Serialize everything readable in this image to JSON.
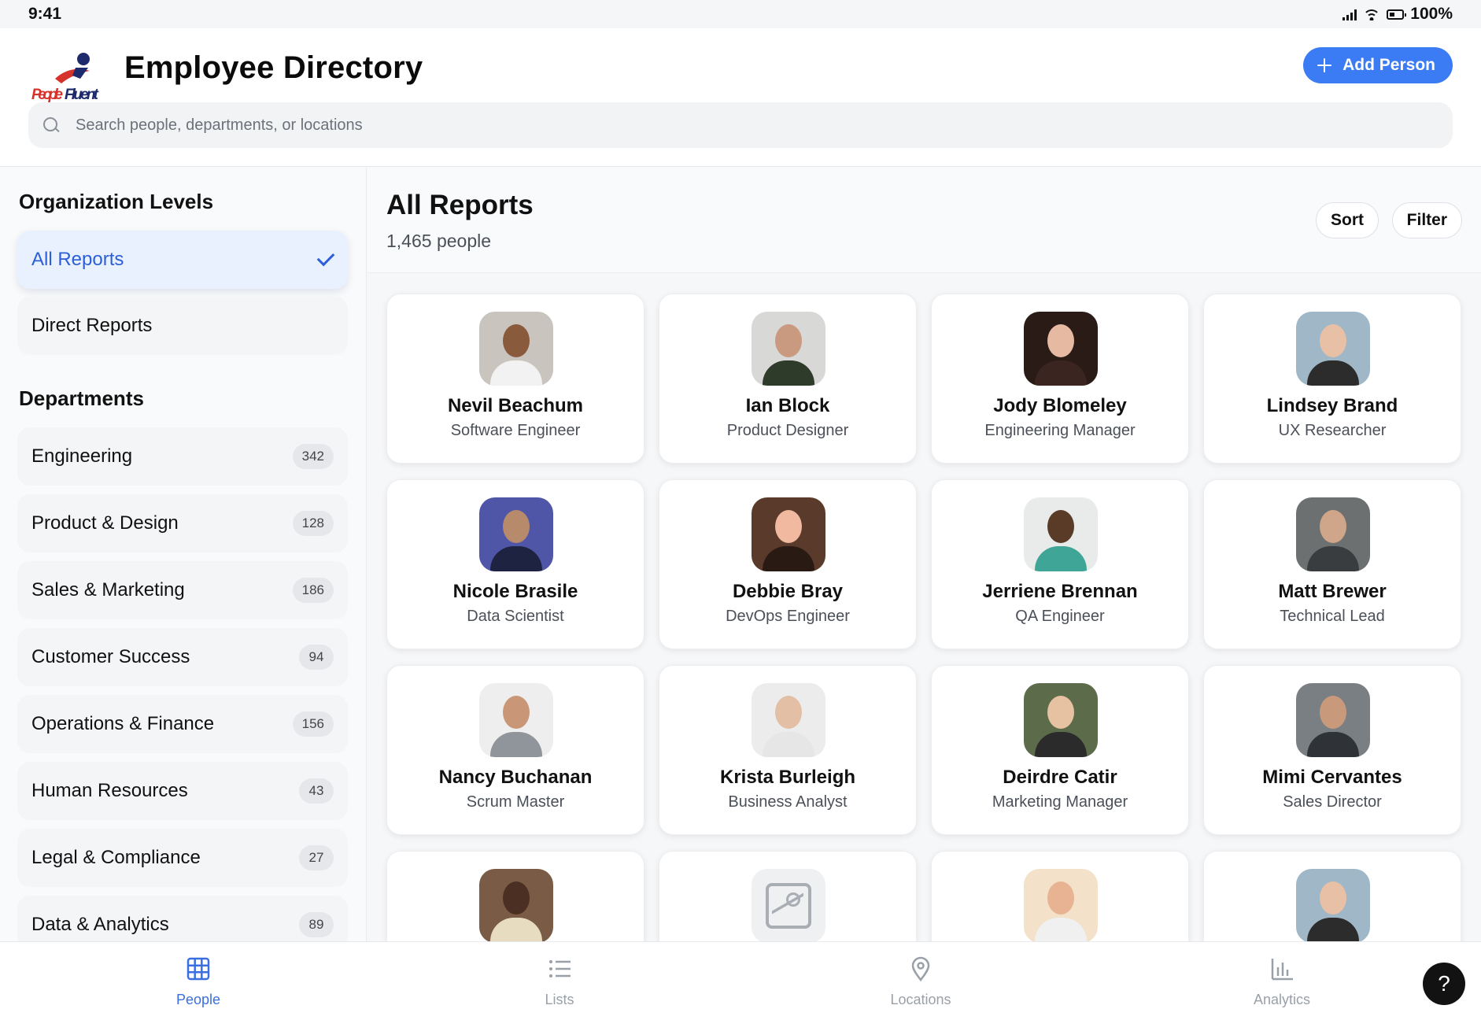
{
  "status": {
    "time": "9:41",
    "battery": "100%"
  },
  "header": {
    "logo_text": "PeopleFluent",
    "title": "Employee Directory",
    "add_label": "Add Person",
    "search_placeholder": "Search people, departments, or locations"
  },
  "sidebar": {
    "levels_heading": "Organization Levels",
    "levels": [
      {
        "label": "All Reports",
        "selected": true
      },
      {
        "label": "Direct Reports",
        "selected": false
      }
    ],
    "departments_heading": "Departments",
    "departments": [
      {
        "label": "Engineering",
        "count": "342"
      },
      {
        "label": "Product & Design",
        "count": "128"
      },
      {
        "label": "Sales & Marketing",
        "count": "186"
      },
      {
        "label": "Customer Success",
        "count": "94"
      },
      {
        "label": "Operations & Finance",
        "count": "156"
      },
      {
        "label": "Human Resources",
        "count": "43"
      },
      {
        "label": "Legal & Compliance",
        "count": "27"
      },
      {
        "label": "Data & Analytics",
        "count": "89"
      }
    ]
  },
  "main": {
    "title": "All Reports",
    "count": "1,465 people",
    "sort_label": "Sort",
    "filter_label": "Filter",
    "people": [
      {
        "name": "Nevil Beachum",
        "role": "Software Engineer",
        "bg": "#c9c4bd",
        "skin": "#8a5a3c",
        "shirt": "#f2f2f2"
      },
      {
        "name": "Ian Block",
        "role": "Product Designer",
        "bg": "#d8d8d6",
        "skin": "#c99a80",
        "shirt": "#2e3a2a"
      },
      {
        "name": "Jody Blomeley",
        "role": "Engineering Manager",
        "bg": "#2a1b16",
        "skin": "#e6b9a2",
        "shirt": "#3a2520"
      },
      {
        "name": "Lindsey Brand",
        "role": "UX Researcher",
        "bg": "#9fb7c6",
        "skin": "#e7c0a6",
        "shirt": "#2c2c2c"
      },
      {
        "name": "Nicole Brasile",
        "role": "Data Scientist",
        "bg": "#4f56a8",
        "skin": "#b88a6c",
        "shirt": "#1d2340"
      },
      {
        "name": "Debbie Bray",
        "role": "DevOps Engineer",
        "bg": "#5a3a2a",
        "skin": "#f0b9a0",
        "shirt": "#2a1a14"
      },
      {
        "name": "Jerriene Brennan",
        "role": "QA Engineer",
        "bg": "#e9eaea",
        "skin": "#5a3b28",
        "shirt": "#3fa596"
      },
      {
        "name": "Matt Brewer",
        "role": "Technical Lead",
        "bg": "#6d7070",
        "skin": "#d0a68a",
        "shirt": "#3a3d40"
      },
      {
        "name": "Nancy Buchanan",
        "role": "Scrum Master",
        "bg": "#eeeeee",
        "skin": "#c99778",
        "shirt": "#8f959b"
      },
      {
        "name": "Krista Burleigh",
        "role": "Business Analyst",
        "bg": "#ececec",
        "skin": "#e3bfa5",
        "shirt": "#e6e6e6"
      },
      {
        "name": "Deirdre Catir",
        "role": "Marketing Manager",
        "bg": "#5c6b4a",
        "skin": "#e6c2a2",
        "shirt": "#2b2b2b"
      },
      {
        "name": "Mimi Cervantes",
        "role": "Sales Director",
        "bg": "#7a7f84",
        "skin": "#c9997c",
        "shirt": "#2f3236"
      },
      {
        "name": "",
        "role": "",
        "bg": "#7a5c46",
        "skin": "#4b2f22",
        "shirt": "#e8dcc0"
      },
      {
        "name": "",
        "role": "",
        "bg": "#eef0f2",
        "skin": "",
        "shirt": "",
        "placeholder": true
      },
      {
        "name": "",
        "role": "",
        "bg": "#f3e2c9",
        "skin": "#e8b392",
        "shirt": "#f0f0f0"
      },
      {
        "name": "",
        "role": "",
        "bg": "#9fb7c6",
        "skin": "#e7c0a6",
        "shirt": "#2c2c2c"
      }
    ]
  },
  "tabs": [
    {
      "label": "People",
      "icon": "grid-icon",
      "active": true
    },
    {
      "label": "Lists",
      "icon": "list-icon",
      "active": false
    },
    {
      "label": "Locations",
      "icon": "map-pin-icon",
      "active": false
    },
    {
      "label": "Analytics",
      "icon": "bar-chart-icon",
      "active": false
    }
  ],
  "help_label": "?",
  "colors": {
    "accent": "#3b7cf5",
    "selected_bg": "#e9f1ff",
    "selected_text": "#2b5fd9",
    "logo_red": "#d6312a",
    "logo_navy": "#1d2a6b"
  }
}
